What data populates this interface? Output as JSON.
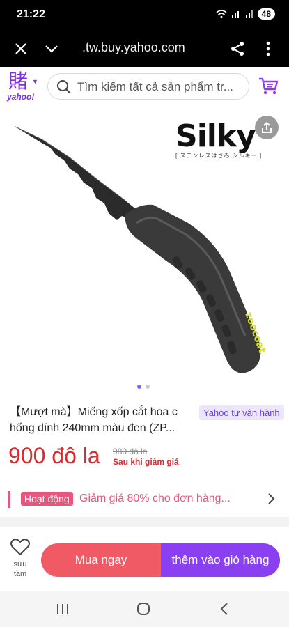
{
  "status_bar": {
    "time": "21:22",
    "battery": "48",
    "icons": [
      "wifi-icon",
      "signal-icon",
      "battery-icon"
    ]
  },
  "browser": {
    "url": ".tw.buy.yahoo.com",
    "icons": [
      "close-icon",
      "chevron-down-icon",
      "share-icon",
      "more-icon"
    ]
  },
  "header": {
    "logo_glyph": "賭",
    "logo_text": "yahoo!",
    "search_placeholder": "Tìm kiếm tất cả sản phẩm tr..."
  },
  "product": {
    "brand_word": "Silky",
    "brand_sub": "[ ステンレスはさみ シルキー ]",
    "handle_text": "zoocoat",
    "carousel": {
      "total": 2,
      "active": 1
    },
    "title_line1": "【Mượt mà】Miếng xốp cắt hoa c",
    "title_line2": "hống dính 240mm màu đen (ZP...",
    "badge": "Yahoo tự vận hành",
    "price": "900 đô la",
    "old_price": "980 đô la",
    "after_discount": "Sau khi giảm giá"
  },
  "promo": {
    "tag": "Hoạt động",
    "text": "Giảm giá 80% cho đơn hàng..."
  },
  "actions": {
    "favorite_label": "sưu tầm",
    "buy_now": "Mua ngay",
    "add_to_cart": "thêm vào giỏ hàng"
  },
  "colors": {
    "brand_purple": "#7b2cf5",
    "price_red": "#e0282e",
    "buy_red": "#ef5a64",
    "cart_purple": "#8a3ff0",
    "promo_pink": "#e8557e"
  }
}
